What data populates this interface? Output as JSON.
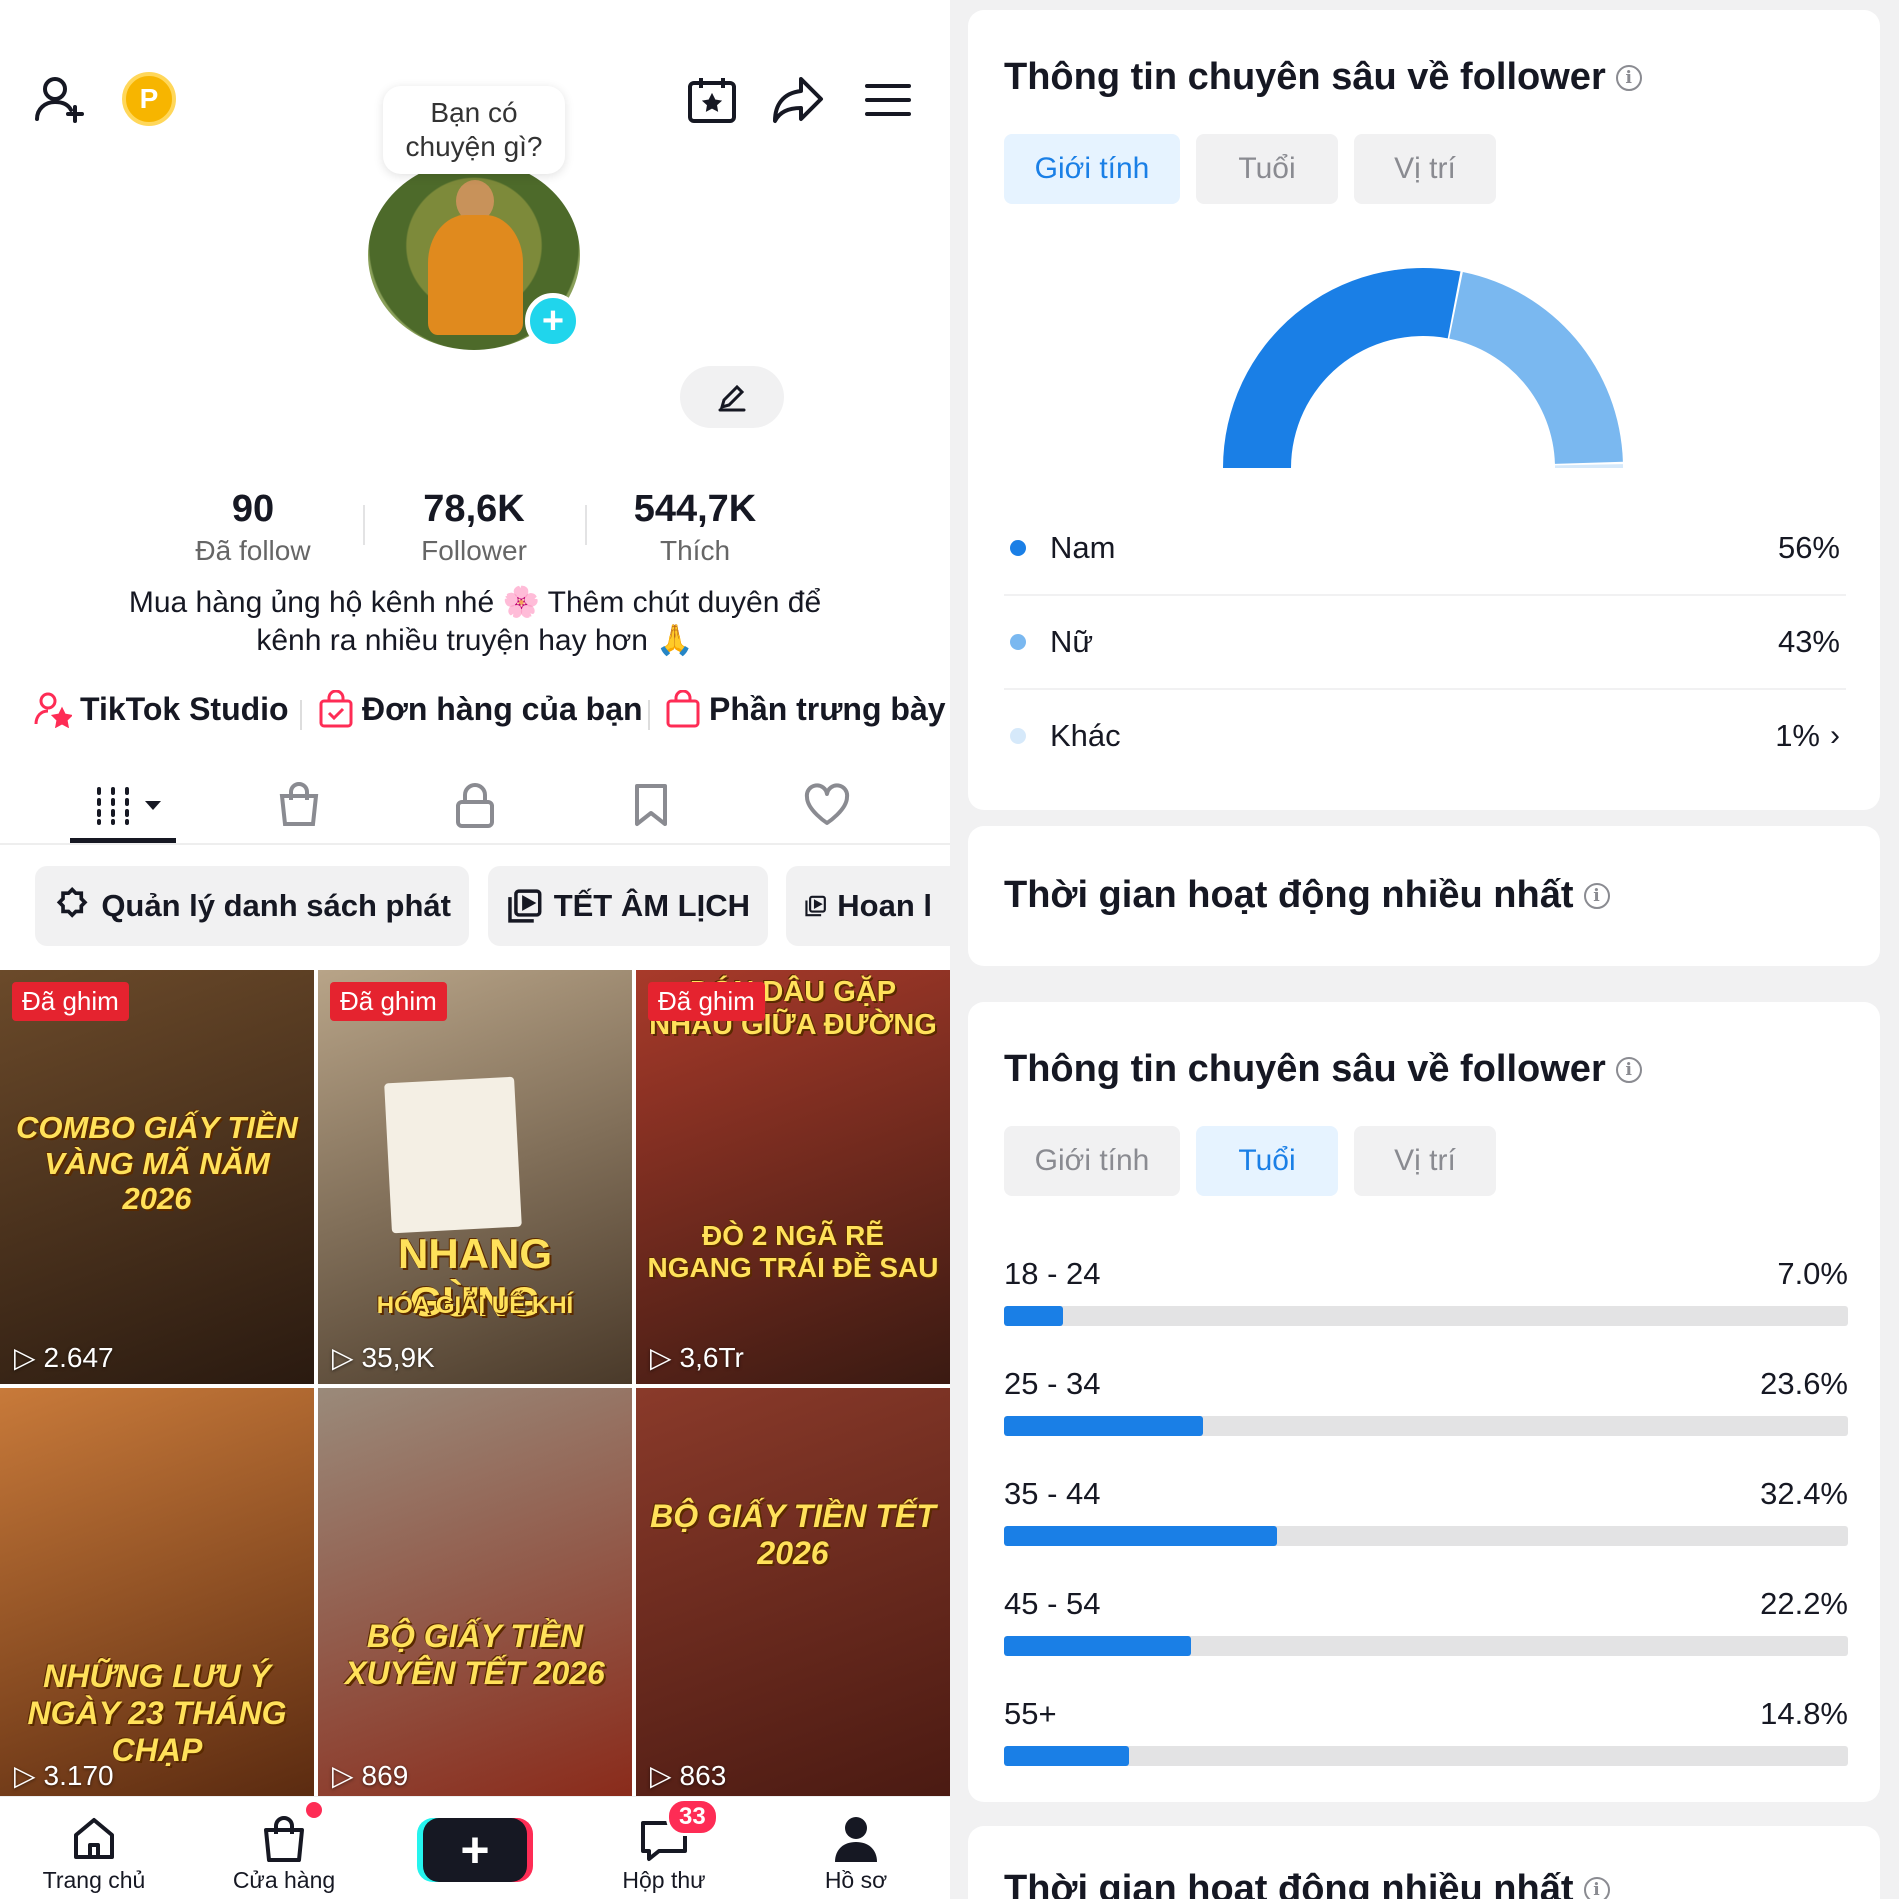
{
  "profile": {
    "bubble_text": "Bạn có chuyện gì?",
    "stats": [
      {
        "num": "90",
        "label": "Đã follow"
      },
      {
        "num": "78,6K",
        "label": "Follower"
      },
      {
        "num": "544,7K",
        "label": "Thích"
      }
    ],
    "bio_line1": "Mua hàng ủng hộ kênh nhé 🌸 Thêm chút duyên để",
    "bio_line2": "kênh ra nhiều truyện hay hơn 🙏",
    "links": {
      "studio": "TikTok Studio",
      "orders": "Đơn hàng của bạn",
      "showcase": "Phần trưng bày"
    },
    "coin_letter": "P"
  },
  "chips": {
    "manage": "Quản lý danh sách phát",
    "tet": "TẾT ÂM LỊCH",
    "hoan": "Hoan l"
  },
  "videos": [
    {
      "pin": "Đã ghim",
      "views": "2.647",
      "caption": "COMBO GIẤY TIỀN VÀNG MÃ NĂM 2026",
      "bg1": "#6b4a2a",
      "bg2": "#2a1a10"
    },
    {
      "pin": "Đã ghim",
      "views": "35,9K",
      "caption": "NHANG GỪNG",
      "sub": "HÓA GIẢI UẾ KHÍ",
      "bg1": "#b8a488",
      "bg2": "#4a3a2a"
    },
    {
      "pin": "Đã ghim",
      "views": "3,6Tr",
      "caption": "ĐÒ 2 NGÃ RẼ NGANG TRÁI ĐỀ SAU",
      "top": "ĐÓN DÂU GẶP NHAU GIỮA ĐƯỜNG",
      "bg1": "#a83a2a",
      "bg2": "#3a1a12"
    },
    {
      "pin": "",
      "views": "3.170",
      "caption": "NHỮNG LƯU Ý NGÀY 23 THÁNG CHẠP",
      "bg1": "#c87a3a",
      "bg2": "#5a2a10"
    },
    {
      "pin": "",
      "views": "869",
      "caption": "BỘ GIẤY TIỀN XUYÊN TẾT 2026",
      "bg1": "#9a8a7a",
      "bg2": "#8a2a1a"
    },
    {
      "pin": "",
      "views": "863",
      "caption": "BỘ GIẤY TIỀN TẾT 2026",
      "bg1": "#8a3a2a",
      "bg2": "#4a1a12"
    }
  ],
  "nav": {
    "home": "Trang chủ",
    "shop": "Cửa hàng",
    "inbox": "Hộp thư",
    "profile": "Hồ sơ",
    "inbox_count": "33",
    "create": "+"
  },
  "insights": {
    "title": "Thông tin chuyên sâu về follower",
    "seg_gender": "Giới tính",
    "seg_age": "Tuổi",
    "seg_location": "Vị trí",
    "gender": [
      {
        "name": "Nam",
        "pct": "56%",
        "value": 56,
        "color": "#1a7fe6"
      },
      {
        "name": "Nữ",
        "pct": "43%",
        "value": 43,
        "color": "#7ab8f0"
      },
      {
        "name": "Khác",
        "pct": "1%",
        "value": 1,
        "color": "#d6e9fa"
      }
    ],
    "active_title": "Thời gian hoạt động nhiều nhất",
    "ages": [
      {
        "label": "18 - 24",
        "pct": "7.0%",
        "value": 7.0
      },
      {
        "label": "25 - 34",
        "pct": "23.6%",
        "value": 23.6
      },
      {
        "label": "35 - 44",
        "pct": "32.4%",
        "value": 32.4
      },
      {
        "label": "45 - 54",
        "pct": "22.2%",
        "value": 22.2
      },
      {
        "label": "55+",
        "pct": "14.8%",
        "value": 14.8
      }
    ],
    "age_max": 100
  },
  "colors": {
    "accent": "#1a7fe6",
    "accent_light": "#7ab8f0",
    "pin_red": "#e5232f",
    "tiktok_red": "#fe2c55",
    "tiktok_cyan": "#25f4ee"
  }
}
